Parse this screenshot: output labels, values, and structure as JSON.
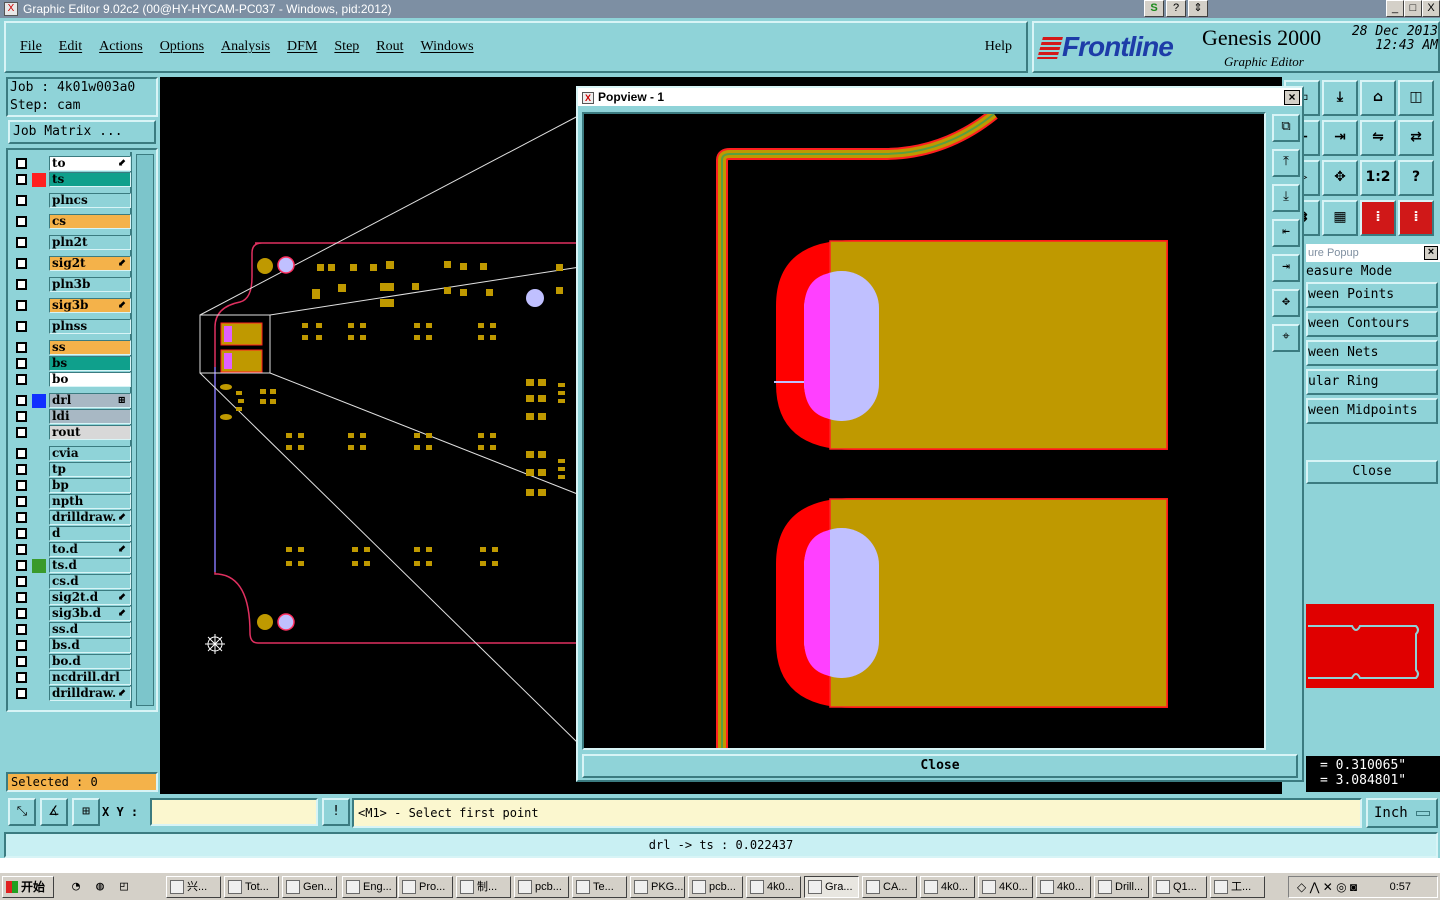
{
  "window": {
    "title": "Graphic Editor 9.02c2 (00@HY-HYCAM-PC037 - Windows, pid:2012)",
    "app_icon": "X",
    "extra_buttons": [
      "S",
      "?",
      "⇕"
    ],
    "controls": [
      "_",
      "□",
      "X"
    ]
  },
  "menu": {
    "items": [
      "File",
      "Edit",
      "Actions",
      "Options",
      "Analysis",
      "DFM",
      "Step",
      "Rout",
      "Windows"
    ],
    "help": "Help"
  },
  "brand": {
    "logo": "Frontline",
    "product": "Genesis 2000",
    "subtitle": "Graphic Editor",
    "date": "28 Dec 2013",
    "time": "12:43 AM"
  },
  "job": {
    "job_line": "Job : 4k01w003a0",
    "step_line": "Step: cam",
    "matrix_button": "Job Matrix ..."
  },
  "layers": [
    {
      "name": "to",
      "bg": "#ffffff",
      "swatch": "",
      "mark": "⬋"
    },
    {
      "name": "ts",
      "bg": "#0fa08c",
      "swatch": "#ff2020",
      "mark": ""
    },
    {
      "name": "plncs",
      "bg": "#8fd3d8",
      "swatch": "",
      "mark": ""
    },
    {
      "name": "cs",
      "bg": "#f4b24a",
      "swatch": "",
      "mark": ""
    },
    {
      "name": "pln2t",
      "bg": "#8fd3d8",
      "swatch": "",
      "mark": ""
    },
    {
      "name": "sig2t",
      "bg": "#f4b24a",
      "swatch": "",
      "mark": "⬋"
    },
    {
      "name": "pln3b",
      "bg": "#8fd3d8",
      "swatch": "",
      "mark": ""
    },
    {
      "name": "sig3b",
      "bg": "#f4b24a",
      "swatch": "",
      "mark": "⬋"
    },
    {
      "name": "plnss",
      "bg": "#8fd3d8",
      "swatch": "",
      "mark": ""
    },
    {
      "name": "ss",
      "bg": "#f4b24a",
      "swatch": "",
      "mark": ""
    },
    {
      "name": "bs",
      "bg": "#0fa08c",
      "swatch": "",
      "mark": ""
    },
    {
      "name": "bo",
      "bg": "#ffffff",
      "swatch": "",
      "mark": ""
    },
    {
      "name": "drl",
      "bg": "#a8b8c4",
      "swatch": "#1030ff",
      "mark": "⊞"
    },
    {
      "name": "ldi",
      "bg": "#a8b8c4",
      "swatch": "",
      "mark": ""
    },
    {
      "name": "rout",
      "bg": "#d8d8d8",
      "swatch": "",
      "mark": ""
    },
    {
      "name": "cvia",
      "bg": "#8fd3d8",
      "swatch": "",
      "mark": ""
    },
    {
      "name": "tp",
      "bg": "#8fd3d8",
      "swatch": "",
      "mark": ""
    },
    {
      "name": "bp",
      "bg": "#8fd3d8",
      "swatch": "",
      "mark": ""
    },
    {
      "name": "npth",
      "bg": "#8fd3d8",
      "swatch": "",
      "mark": ""
    },
    {
      "name": "drilldraw.",
      "bg": "#8fd3d8",
      "swatch": "",
      "mark": "⬋"
    },
    {
      "name": "d",
      "bg": "#8fd3d8",
      "swatch": "",
      "mark": ""
    },
    {
      "name": "to.d",
      "bg": "#8fd3d8",
      "swatch": "",
      "mark": "⬋"
    },
    {
      "name": "ts.d",
      "bg": "#8fd3d8",
      "swatch": "#3a9a2a",
      "mark": ""
    },
    {
      "name": "cs.d",
      "bg": "#8fd3d8",
      "swatch": "",
      "mark": ""
    },
    {
      "name": "sig2t.d",
      "bg": "#8fd3d8",
      "swatch": "",
      "mark": "⬋"
    },
    {
      "name": "sig3b.d",
      "bg": "#8fd3d8",
      "swatch": "",
      "mark": "⬋"
    },
    {
      "name": "ss.d",
      "bg": "#8fd3d8",
      "swatch": "",
      "mark": ""
    },
    {
      "name": "bs.d",
      "bg": "#8fd3d8",
      "swatch": "",
      "mark": ""
    },
    {
      "name": "bo.d",
      "bg": "#8fd3d8",
      "swatch": "",
      "mark": ""
    },
    {
      "name": "ncdrill.drl",
      "bg": "#8fd3d8",
      "swatch": "",
      "mark": ""
    },
    {
      "name": "drilldraw.",
      "bg": "#8fd3d8",
      "swatch": "",
      "mark": "⬋"
    }
  ],
  "selected": "Selected : 0",
  "popview": {
    "title": "Popview - 1",
    "close": "Close",
    "tools": [
      "zoom-window-icon",
      "zoom-top-icon",
      "zoom-bottom-icon",
      "zoom-left-icon",
      "zoom-right-icon",
      "zoom-fit-icon",
      "zoom-center-icon"
    ]
  },
  "right_tools": [
    {
      "icon": "zoom-window-icon",
      "glyph": "▭"
    },
    {
      "icon": "zoom-in-icon",
      "glyph": "⤓"
    },
    {
      "icon": "home-icon",
      "glyph": "⌂"
    },
    {
      "icon": "split-icon",
      "glyph": "◫"
    },
    {
      "icon": "zoom-left-icon",
      "glyph": "⇤"
    },
    {
      "icon": "zoom-right-icon",
      "glyph": "⇥"
    },
    {
      "icon": "zoom-out-icon",
      "glyph": "⇋"
    },
    {
      "icon": "switch-icon",
      "glyph": "⇄"
    },
    {
      "icon": "pan-right-icon",
      "glyph": "▷"
    },
    {
      "icon": "move-icon",
      "glyph": "✥"
    },
    {
      "icon": "scale-icon",
      "glyph": "1:2"
    },
    {
      "icon": "help-icon",
      "glyph": "?"
    },
    {
      "icon": "pan-icon",
      "glyph": "⇉"
    },
    {
      "icon": "grid-icon",
      "glyph": "▦"
    },
    {
      "icon": "layer-a-icon",
      "glyph": "⁞"
    },
    {
      "icon": "layer-b-icon",
      "glyph": "⁞"
    }
  ],
  "measure": {
    "title": "ure Popup",
    "mode": "easure Mode",
    "buttons": [
      "ween Points",
      "ween Contours",
      "ween Nets",
      "ular Ring",
      "ween Midpoints"
    ],
    "close": "Close",
    "x": "= 0.310065\"",
    "y": "= 3.084801\""
  },
  "cmd": {
    "xy_label": "X Y :",
    "xy_value": "",
    "prompt": "<M1> - Select first point",
    "unit": "Inch",
    "status": "drl -> ts : 0.022437"
  },
  "taskbar": {
    "start": "开始",
    "quicklaunch": [
      "◔",
      "◍",
      "◰"
    ],
    "tasks": [
      "兴...",
      "Tot...",
      "Gen...",
      "Eng...",
      "Pro...",
      "制...",
      "pcb...",
      "Te...",
      "PKG...",
      "pcb...",
      "4k0...",
      "Gra...",
      "CA...",
      "4k0...",
      "4K0...",
      "4k0...",
      "Drill...",
      "Q1...",
      "工..."
    ],
    "active_task": 11,
    "clock": "0:57"
  },
  "colors": {
    "panel": "#8fd3d8",
    "copper": "#bf9900",
    "solder_mask": "#ff0000",
    "drill_overlay": "#c0c0ff",
    "board_outline": "#e03060"
  }
}
